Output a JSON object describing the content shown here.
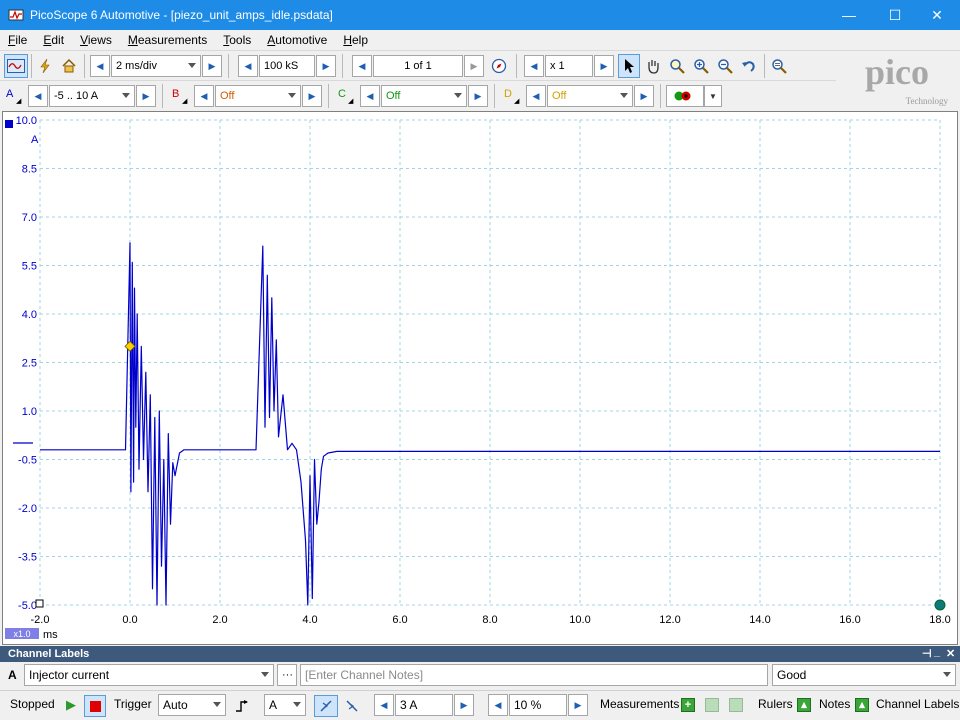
{
  "window": {
    "title": "PicoScope 6 Automotive - [piezo_unit_amps_idle.psdata]",
    "minimize": "—",
    "maximize": "☐",
    "close": "✕"
  },
  "menu": [
    "File",
    "Edit",
    "Views",
    "Measurements",
    "Tools",
    "Automotive",
    "Help"
  ],
  "toolbar": {
    "timebase": "2 ms/div",
    "samples": "100 kS",
    "buffer": "1 of 1",
    "zoom": "x 1"
  },
  "channels": {
    "a": {
      "label": "A",
      "range": "-5 .. 10 A"
    },
    "b": {
      "label": "B",
      "range": "Off"
    },
    "c": {
      "label": "C",
      "range": "Off"
    },
    "d": {
      "label": "D",
      "range": "Off"
    }
  },
  "logo": {
    "brand": "pico",
    "tagline": "Technology"
  },
  "chart_data": {
    "type": "line",
    "ylabel": "A",
    "xlabel": "ms",
    "ylim": [
      -5.0,
      10.0
    ],
    "xlim": [
      -2.0,
      18.0
    ],
    "y_ticks": [
      "10.0",
      "8.5",
      "7.0",
      "5.5",
      "4.0",
      "2.5",
      "1.0",
      "-0.5",
      "-2.0",
      "-3.5",
      "-5.0"
    ],
    "x_ticks": [
      "-2.0",
      "0.0",
      "2.0",
      "4.0",
      "6.0",
      "8.0",
      "10.0",
      "12.0",
      "14.0",
      "16.0",
      "18.0"
    ],
    "zoom_badge": "x1.0",
    "grid": true,
    "trigger_marker": {
      "x": 0.0,
      "y": 3.0
    },
    "series": [
      {
        "color": "#0000cc",
        "x": [
          -2.0,
          -0.1,
          0.0,
          0.02,
          0.05,
          0.08,
          0.1,
          0.13,
          0.16,
          0.2,
          0.25,
          0.3,
          0.35,
          0.4,
          0.45,
          0.5,
          0.55,
          0.6,
          0.65,
          0.7,
          0.75,
          0.8,
          0.85,
          0.9,
          0.95,
          1.0,
          1.1,
          1.2,
          1.4,
          2.0,
          2.8,
          2.95,
          3.0,
          3.05,
          3.1,
          3.15,
          3.2,
          3.25,
          3.3,
          3.4,
          3.5,
          3.6,
          3.7,
          3.8,
          3.9,
          3.95,
          4.0,
          4.05,
          4.1,
          4.15,
          4.2,
          4.25,
          4.3,
          4.4,
          4.6,
          6.0,
          10.0,
          14.0,
          18.0
        ],
        "y": [
          -0.2,
          -0.2,
          6.2,
          -1.5,
          5.6,
          -1.2,
          4.8,
          0.5,
          4.0,
          -0.8,
          3.0,
          -0.5,
          2.2,
          -1.5,
          1.5,
          -4.5,
          0.8,
          -5.0,
          1.0,
          -3.8,
          -0.5,
          -5.0,
          0.3,
          -2.5,
          -0.6,
          -1.0,
          -0.3,
          -0.2,
          -0.2,
          -0.2,
          -0.2,
          6.1,
          0.5,
          5.2,
          0.8,
          4.5,
          1.0,
          3.2,
          0.2,
          1.5,
          -0.2,
          0.0,
          -0.2,
          -1.2,
          -3.0,
          -5.0,
          -1.0,
          -4.8,
          -0.5,
          -2.5,
          -1.8,
          -0.8,
          -0.4,
          -0.3,
          -0.25,
          -0.25,
          -0.25,
          -0.25,
          -0.25
        ]
      }
    ]
  },
  "channel_labels": {
    "header": "Channel Labels",
    "channel": "A",
    "name": "Injector current",
    "notes_placeholder": "[Enter Channel Notes]",
    "quality": "Good"
  },
  "status": {
    "state": "Stopped",
    "trigger_label": "Trigger",
    "trigger_mode": "Auto",
    "trigger_channel": "A",
    "threshold": "3 A",
    "pretrigger": "10 %",
    "measurements": "Measurements",
    "rulers": "Rulers",
    "notes": "Notes",
    "channel_labels": "Channel Labels"
  }
}
